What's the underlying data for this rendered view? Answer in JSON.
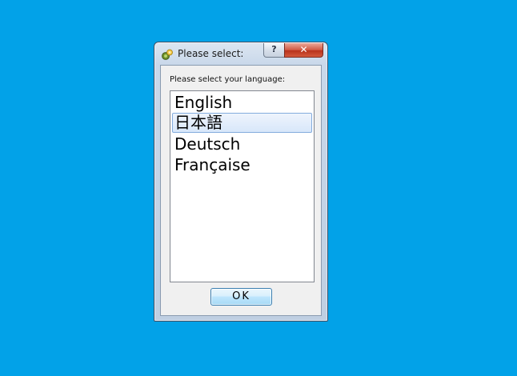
{
  "desktop": {
    "background_color": "#02a2e8"
  },
  "window": {
    "title": "Please select:",
    "app_icon": "app-icon",
    "help_label": "?",
    "close_label": "✕"
  },
  "dialog": {
    "prompt": "Please select your language:",
    "languages": [
      {
        "label": "English",
        "selected": false
      },
      {
        "label": "日本語",
        "selected": true
      },
      {
        "label": "Deutsch",
        "selected": false
      },
      {
        "label": "Française",
        "selected": false
      }
    ],
    "ok_label": "OK"
  }
}
